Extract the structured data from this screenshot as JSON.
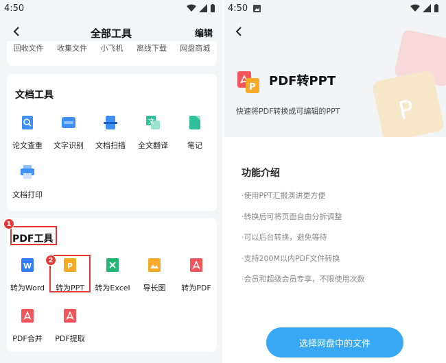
{
  "colors": {
    "accent_blue": "#38a8f5",
    "highlight_red": "#e53935",
    "page_bg": "#f4f5f7",
    "card_bg": "#ffffff"
  },
  "left": {
    "status": {
      "time": "4:50"
    },
    "header": {
      "title": "全部工具",
      "edit_label": "编辑"
    },
    "top_row_cut": [
      "回收文件",
      "收集文件",
      "小飞机",
      "离线下载",
      "网盘商城"
    ],
    "doc_tools": {
      "title": "文档工具",
      "items": [
        {
          "label": "论文查重",
          "icon": "paper-check-icon"
        },
        {
          "label": "文字识别",
          "icon": "ocr-icon"
        },
        {
          "label": "文档扫描",
          "icon": "scan-icon"
        },
        {
          "label": "全文翻译",
          "icon": "translate-icon"
        },
        {
          "label": "笔记",
          "icon": "note-icon"
        },
        {
          "label": "文档打印",
          "icon": "printer-icon"
        }
      ]
    },
    "pdf_tools": {
      "title": "PDF工具",
      "items": [
        {
          "label": "转为Word",
          "icon": "word-icon"
        },
        {
          "label": "转为PPT",
          "icon": "ppt-icon"
        },
        {
          "label": "转为Excel",
          "icon": "excel-icon"
        },
        {
          "label": "导长图",
          "icon": "image-icon"
        },
        {
          "label": "转为PDF",
          "icon": "pdf-icon"
        },
        {
          "label": "PDF合并",
          "icon": "pdf-merge-icon"
        },
        {
          "label": "PDF提取",
          "icon": "pdf-extract-icon"
        }
      ]
    },
    "badges": [
      "1",
      "2"
    ]
  },
  "right": {
    "status": {
      "time": "4:50"
    },
    "hero": {
      "title": "PDF转PPT",
      "subtitle": "快速将PDF转换成可编辑的PPT"
    },
    "features": {
      "title": "功能介绍",
      "items": [
        "·使用PPT汇报演讲更方便",
        "·转换后可将页面自由分拆调整",
        "·可以后台转换，避免等待",
        "·支持200M以内PDF文件转换",
        "·会员和超级会员专享，不限使用次数"
      ]
    },
    "cta_label": "选择网盘中的文件"
  }
}
